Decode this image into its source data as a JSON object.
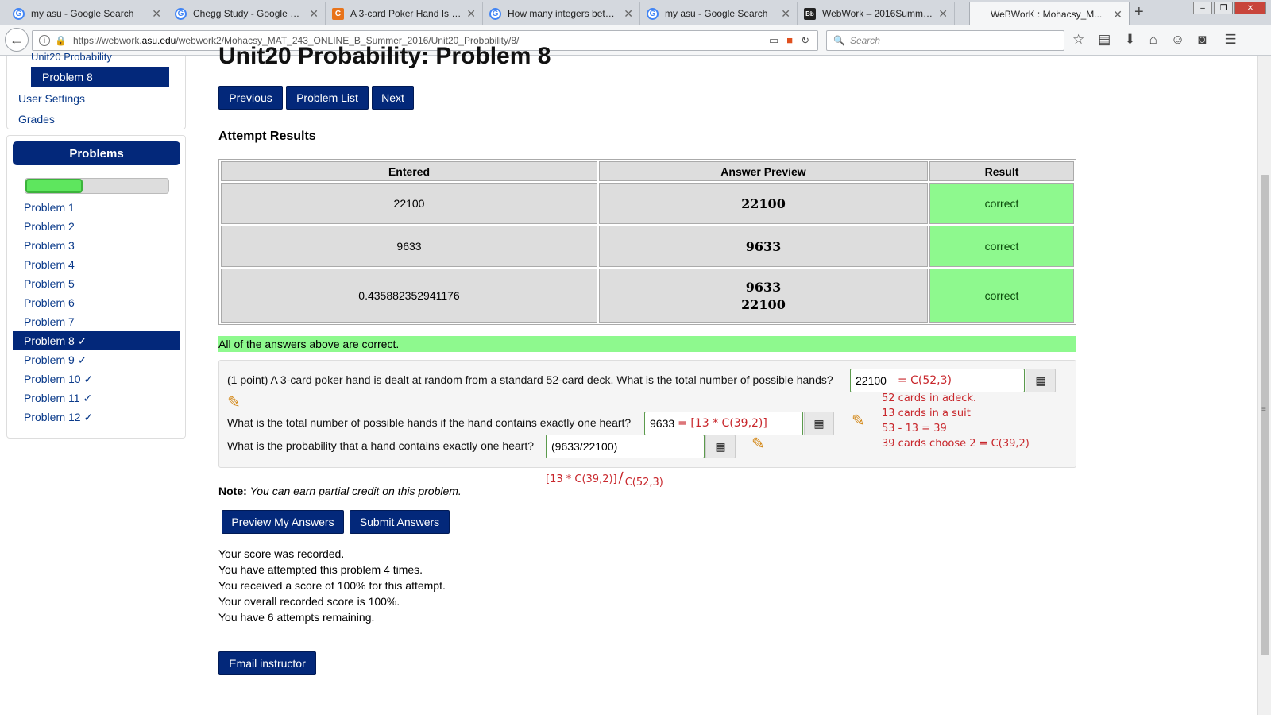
{
  "browser": {
    "tabs": [
      {
        "title": "my asu - Google Search",
        "icon": "google-icon"
      },
      {
        "title": "Chegg Study - Google Se...",
        "icon": "google-icon"
      },
      {
        "title": "A 3-card Poker Hand Is D...",
        "icon": "chegg-icon"
      },
      {
        "title": "How many integers betw...",
        "icon": "google-icon"
      },
      {
        "title": "my asu - Google Search",
        "icon": "google-icon"
      },
      {
        "title": "WebWork – 2016Summer...",
        "icon": "blackboard-icon"
      },
      {
        "title": "WeBWorK : Mohacsy_M...",
        "icon": "none"
      }
    ],
    "url_prefix": "https://webwork.",
    "url_domain": "asu.edu",
    "url_path": "/webwork2/Mohacsy_MAT_243_ONLINE_B_Summer_2016/Unit20_Probability/8/",
    "search_placeholder": "Search"
  },
  "sidebar": {
    "set_link": "Unit20 Probability",
    "current_problem": "Problem 8",
    "links": [
      "User Settings",
      "Grades"
    ],
    "problems_heading": "Problems",
    "progress_fraction": 0.4,
    "problems": [
      {
        "label": "Problem 1"
      },
      {
        "label": "Problem 2"
      },
      {
        "label": "Problem 3"
      },
      {
        "label": "Problem 4"
      },
      {
        "label": "Problem 5"
      },
      {
        "label": "Problem 6"
      },
      {
        "label": "Problem 7"
      },
      {
        "label": "Problem 8 ✓",
        "active": true
      },
      {
        "label": "Problem 9 ✓"
      },
      {
        "label": "Problem 10 ✓"
      },
      {
        "label": "Problem 11 ✓"
      },
      {
        "label": "Problem 12 ✓"
      }
    ]
  },
  "main": {
    "title": "Unit20 Probability: Problem 8",
    "nav_buttons": {
      "previous": "Previous",
      "problem_list": "Problem List",
      "next": "Next"
    },
    "attempt_heading": "Attempt Results",
    "results": {
      "headers": [
        "Entered",
        "Answer Preview",
        "Result"
      ],
      "rows": [
        {
          "entered": "22100",
          "preview": "22100",
          "result": "correct"
        },
        {
          "entered": "9633",
          "preview": "9633",
          "result": "correct"
        },
        {
          "entered": "0.435882352941176",
          "preview_num": "9633",
          "preview_den": "22100",
          "result": "correct"
        }
      ]
    },
    "all_correct": "All of the answers above are correct.",
    "problem": {
      "q1": "(1 point) A 3-card poker hand is dealt at random from a standard 52-card deck. What is the total number of possible hands?",
      "a1_value": "22100",
      "a1_note": "=   C(52,3)",
      "q2": "What is the total number of possible hands if the hand contains exactly one heart?",
      "a2_value": "9633",
      "a2_note": "= [13 * C(39,2)]",
      "q3": "What is the probability that a hand contains exactly one heart?",
      "a3_value": "(9633/22100)",
      "side_notes": [
        "52 cards in adeck.",
        "13 cards in a suit",
        "53 - 13 = 39",
        "39 cards choose 2 = C(39,2)"
      ],
      "below_note_num": "[13 * C(39,2)]",
      "below_note_den": "C(52,3)"
    },
    "note_label": "Note:",
    "note_text": "You can earn partial credit on this problem.",
    "buttons": {
      "preview": "Preview My Answers",
      "submit": "Submit Answers",
      "email": "Email instructor"
    },
    "status_lines": [
      "Your score was recorded.",
      "You have attempted this problem 4 times.",
      "You received a score of 100% for this attempt.",
      "Your overall recorded score is 100%.",
      "You have 6 attempts remaining."
    ]
  }
}
